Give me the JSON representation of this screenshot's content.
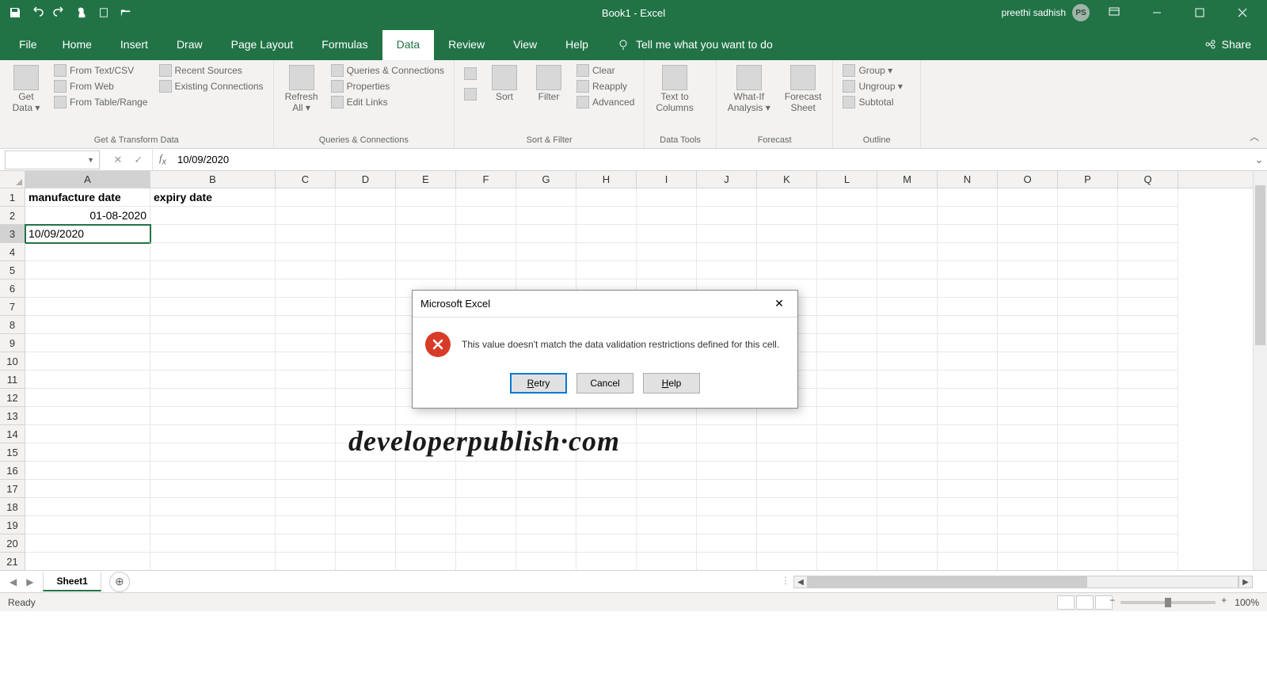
{
  "title": "Book1  -  Excel",
  "user": {
    "name": "preethi sadhish",
    "initials": "PS"
  },
  "share_label": "Share",
  "tabs": [
    "File",
    "Home",
    "Insert",
    "Draw",
    "Page Layout",
    "Formulas",
    "Data",
    "Review",
    "View",
    "Help"
  ],
  "active_tab": "Data",
  "tellme_placeholder": "Tell me what you want to do",
  "ribbon": {
    "groups": [
      {
        "label": "Get & Transform Data",
        "big": [
          {
            "label": "Get\nData ▾"
          }
        ],
        "items": [
          "From Text/CSV",
          "From Web",
          "From Table/Range",
          "Recent Sources",
          "Existing Connections"
        ]
      },
      {
        "label": "Queries & Connections",
        "big": [
          {
            "label": "Refresh\nAll ▾"
          }
        ],
        "items": [
          "Queries & Connections",
          "Properties",
          "Edit Links"
        ]
      },
      {
        "label": "Sort & Filter",
        "big": [
          {
            "label": "Sort"
          },
          {
            "label": "Filter"
          }
        ],
        "items": [
          "Clear",
          "Reapply",
          "Advanced"
        ]
      },
      {
        "label": "Data Tools",
        "big": [
          {
            "label": "Text to\nColumns"
          }
        ],
        "items": []
      },
      {
        "label": "Forecast",
        "big": [
          {
            "label": "What-If\nAnalysis ▾"
          },
          {
            "label": "Forecast\nSheet"
          }
        ],
        "items": []
      },
      {
        "label": "Outline",
        "big": [],
        "items": [
          "Group ▾",
          "Ungroup ▾",
          "Subtotal"
        ]
      }
    ]
  },
  "namebox": "",
  "formula": "10/09/2020",
  "columns": [
    "A",
    "B",
    "C",
    "D",
    "E",
    "F",
    "G",
    "H",
    "I",
    "J",
    "K",
    "L",
    "M",
    "N",
    "O",
    "P",
    "Q"
  ],
  "active_cell": {
    "row": 3,
    "col": "A"
  },
  "cells": {
    "A1": "manufacture date",
    "B1": "expiry date",
    "A2": "01-08-2020",
    "A3": "10/09/2020"
  },
  "watermark": "developerpublish·com",
  "dialog": {
    "title": "Microsoft Excel",
    "message": "This value doesn't match the data validation restrictions defined for this cell.",
    "buttons": {
      "retry": "Retry",
      "cancel": "Cancel",
      "help": "Help"
    }
  },
  "sheet_tab": "Sheet1",
  "status": "Ready",
  "zoom": "100%"
}
